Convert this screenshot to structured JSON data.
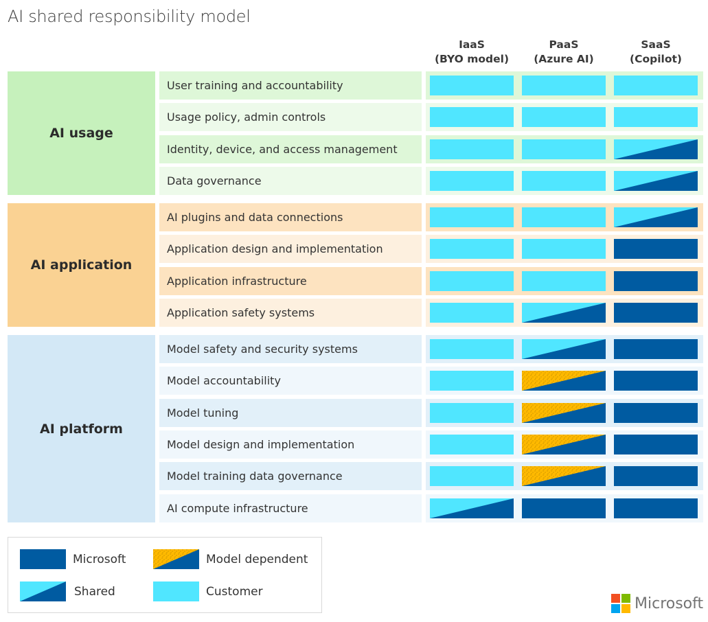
{
  "title": "AI shared responsibility model",
  "colors": {
    "microsoft": "#005ba1",
    "customer": "#50e6ff",
    "model_dependent": "#ffb900",
    "usage_cat": "#c6f1bc",
    "usage_row_a": "#def7d8",
    "usage_row_b": "#edfaea",
    "app_cat": "#fad293",
    "app_row_a": "#fde3c0",
    "app_row_b": "#fdf0df",
    "platform_cat": "#d3e8f6",
    "platform_row_a": "#e2f0f9",
    "platform_row_b": "#f0f7fc"
  },
  "columns": [
    {
      "line1": "IaaS",
      "line2": "(BYO model)"
    },
    {
      "line1": "PaaS",
      "line2": "(Azure AI)"
    },
    {
      "line1": "SaaS",
      "line2": "(Copilot)"
    }
  ],
  "chart_data": {
    "type": "table",
    "title": "AI shared responsibility model",
    "columns": [
      "IaaS (BYO model)",
      "PaaS (Azure AI)",
      "SaaS (Copilot)"
    ],
    "legend": {
      "microsoft": "Microsoft",
      "shared": "Shared",
      "model_dependent": "Model dependent",
      "customer": "Customer"
    },
    "sections": [
      {
        "name": "AI usage",
        "rows": [
          {
            "label": "User training and accountability",
            "values": [
              "customer",
              "customer",
              "customer"
            ]
          },
          {
            "label": "Usage policy, admin controls",
            "values": [
              "customer",
              "customer",
              "customer"
            ]
          },
          {
            "label": "Identity, device, and access management",
            "values": [
              "customer",
              "customer",
              "shared"
            ]
          },
          {
            "label": "Data governance",
            "values": [
              "customer",
              "customer",
              "shared"
            ]
          }
        ]
      },
      {
        "name": "AI application",
        "rows": [
          {
            "label": "AI plugins and data connections",
            "values": [
              "customer",
              "customer",
              "shared"
            ]
          },
          {
            "label": "Application design and implementation",
            "values": [
              "customer",
              "customer",
              "microsoft"
            ]
          },
          {
            "label": "Application infrastructure",
            "values": [
              "customer",
              "customer",
              "microsoft"
            ]
          },
          {
            "label": "Application safety systems",
            "values": [
              "customer",
              "shared",
              "microsoft"
            ]
          }
        ]
      },
      {
        "name": "AI platform",
        "rows": [
          {
            "label": "Model safety and security systems",
            "values": [
              "customer",
              "shared",
              "microsoft"
            ]
          },
          {
            "label": "Model accountability",
            "values": [
              "customer",
              "model_dependent",
              "microsoft"
            ]
          },
          {
            "label": "Model tuning",
            "values": [
              "customer",
              "model_dependent",
              "microsoft"
            ]
          },
          {
            "label": "Model design and implementation",
            "values": [
              "customer",
              "model_dependent",
              "microsoft"
            ]
          },
          {
            "label": "Model training data governance",
            "values": [
              "customer",
              "model_dependent",
              "microsoft"
            ]
          },
          {
            "label": "AI compute infrastructure",
            "values": [
              "shared",
              "microsoft",
              "microsoft"
            ]
          }
        ]
      }
    ]
  },
  "legend": {
    "microsoft": "Microsoft",
    "model_dependent": "Model dependent",
    "shared": "Shared",
    "customer": "Customer"
  },
  "brand": {
    "logo_text": "Microsoft",
    "logo_colors": [
      "#f25022",
      "#7fba00",
      "#00a4ef",
      "#ffb900"
    ]
  }
}
